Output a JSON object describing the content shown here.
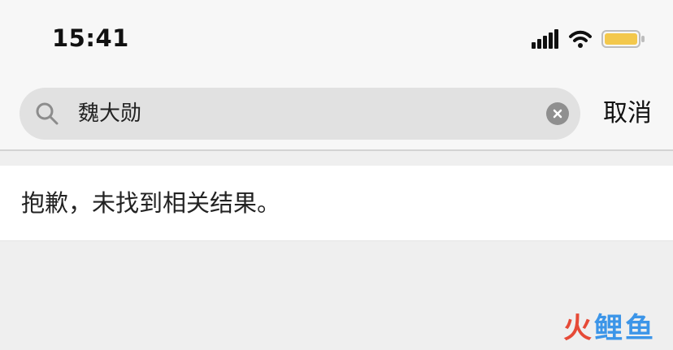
{
  "status_bar": {
    "time": "15:41"
  },
  "search": {
    "query": "魏大勋",
    "cancel_label": "取消"
  },
  "results": {
    "empty_message": "抱歉，未找到相关结果。"
  },
  "watermark": {
    "char_1": "火",
    "char_2": "鲤",
    "char_3": "鱼"
  },
  "icons": {
    "signal": "signal-bars-icon",
    "wifi": "wifi-icon",
    "battery": "battery-icon",
    "search": "search-icon",
    "clear": "clear-circle-icon"
  },
  "colors": {
    "battery_fill": "#f3c84c",
    "watermark_red": "#e63e2a",
    "watermark_blue": "#2f8fe8"
  }
}
